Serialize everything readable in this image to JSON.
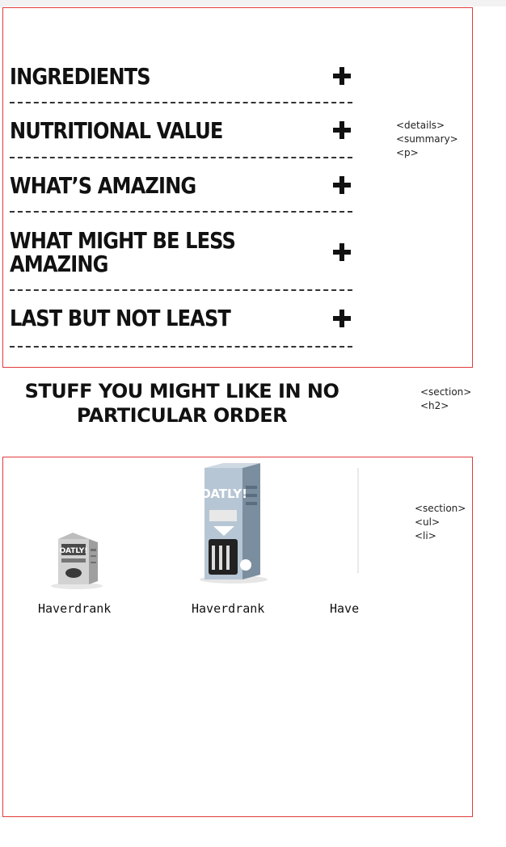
{
  "accordion": {
    "items": [
      {
        "label": "INGREDIENTS"
      },
      {
        "label": "NUTRITIONAL VALUE"
      },
      {
        "label": "WHAT’S AMAZING"
      },
      {
        "label": "WHAT MIGHT BE LESS AMAZING"
      },
      {
        "label": "LAST BUT NOT LEAST"
      }
    ]
  },
  "annotations": {
    "details": [
      "<details>",
      "<summary>",
      "<p>"
    ],
    "section": [
      "<section>",
      "<h2>"
    ],
    "products": [
      "<section>",
      "<ul>",
      "<li>"
    ]
  },
  "related": {
    "title": "STUFF YOU MIGHT LIKE IN NO PARTICULAR ORDER",
    "products": [
      {
        "name": "Haverdrank",
        "image_text": "OATLY!"
      },
      {
        "name": "Haverdrank",
        "image_text": "OATLY!"
      },
      {
        "name": "Haverdrank"
      }
    ]
  },
  "colors": {
    "outline": "#e23b3b",
    "text": "#111111"
  }
}
